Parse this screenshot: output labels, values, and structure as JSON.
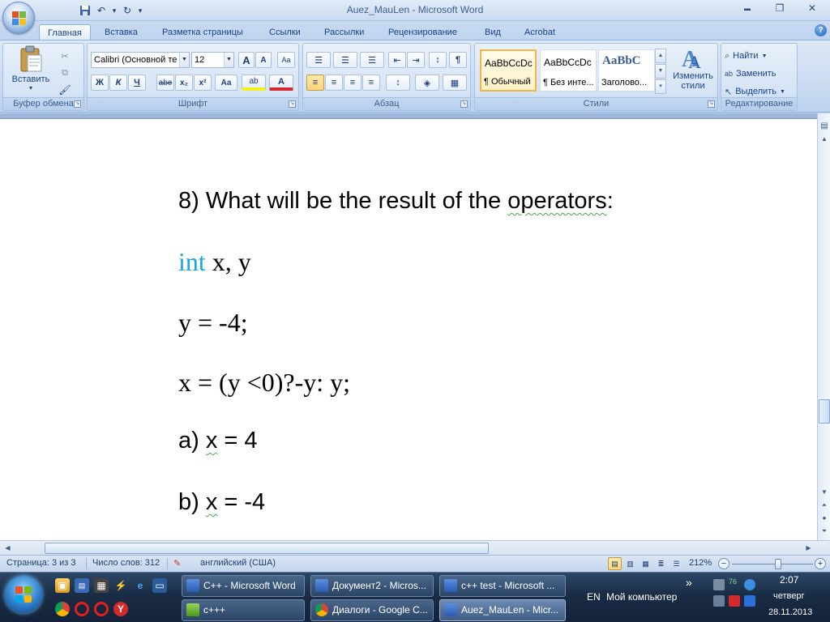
{
  "window": {
    "title": "Auez_MauLen - Microsoft Word",
    "minimize": "▬",
    "maximize": "❐",
    "close": "✕"
  },
  "qat": {
    "save": "💾",
    "undo": "↶",
    "undo_dd": "▾",
    "redo": "↻",
    "customize": "▾"
  },
  "tabs": [
    {
      "label": "Главная",
      "active": true
    },
    {
      "label": "Вставка"
    },
    {
      "label": "Разметка страницы"
    },
    {
      "label": "Ссылки"
    },
    {
      "label": "Рассылки"
    },
    {
      "label": "Рецензирование"
    },
    {
      "label": "Вид"
    },
    {
      "label": "Acrobat"
    }
  ],
  "help": "?",
  "ribbon": {
    "clipboard": {
      "label": "Буфер обмена",
      "paste": "Вставить",
      "paste_dd": "▾",
      "cut": "✂",
      "copy": "⧉",
      "format_painter": "🖌"
    },
    "font": {
      "label": "Шрифт",
      "font_name": "Calibri (Основной те",
      "font_size": "12",
      "grow": "A",
      "shrink": "A",
      "clear": "Aa",
      "bold": "Ж",
      "italic": "К",
      "underline": "Ч",
      "strike": "abe",
      "subscript": "x₂",
      "superscript": "x²",
      "case": "Aa",
      "highlight": "ab",
      "color": "A"
    },
    "paragraph": {
      "label": "Абзац",
      "bullets": "☰",
      "numbering": "☰",
      "multilevel": "☰",
      "dec_indent": "⇤",
      "inc_indent": "⇥",
      "sort": "↕",
      "pilcrow": "¶",
      "align_left": "≡",
      "align_center": "≡",
      "align_right": "≡",
      "justify": "≡",
      "line_spacing": "↕",
      "shading": "◈",
      "borders": "▦"
    },
    "styles": {
      "label": "Стили",
      "items": [
        {
          "sample": "AaBbCcDc",
          "name": "¶ Обычный",
          "active": true
        },
        {
          "sample": "AaBbCcDc",
          "name": "¶ Без инте..."
        },
        {
          "sample": "AaBbC",
          "name": "Заголово..."
        }
      ],
      "change_styles": "Изменить стили",
      "change_dd": "▾"
    },
    "editing": {
      "label": "Редактирование",
      "find": "Найти",
      "replace": "Заменить",
      "select": "Выделить"
    }
  },
  "document": {
    "line1": "8) What will be the result of the ",
    "line1_b": "operators",
    "line1_c": ":",
    "line2_kw": "int",
    "line2_rest": " x, y",
    "line3": "y = -4;",
    "line4": "x = (y <0)?-y: y;",
    "line5_a": "a) ",
    "line5_b": "x",
    "line5_c": " = 4",
    "line6_a": "b) ",
    "line6_b": "x",
    "line6_c": " = -4"
  },
  "statusbar": {
    "page": "Страница: 3 из 3",
    "words": "Число слов: 312",
    "language": "английский (США)",
    "zoom": "212%",
    "zoom_out": "−",
    "zoom_in": "+"
  },
  "taskbar": {
    "tasks": [
      {
        "label": "C++ - Microsoft Word",
        "active": false
      },
      {
        "label": "Документ2 - Micros..."
      },
      {
        "label": "c++ test - Microsoft ..."
      },
      {
        "label": "c+++"
      },
      {
        "label": "Диалоги - Google C..."
      },
      {
        "label": "Auez_MauLen - Micr...",
        "active": true
      }
    ],
    "more": "»",
    "lang": "EN",
    "my_computer": "Мой компьютер",
    "clock_time": "2:07",
    "clock_day": "четверг",
    "clock_date": "28.11.2013",
    "tray_count": "76"
  },
  "colors": {
    "ribbon_bg": "#c7d9f0",
    "keyword": "#1aa6e0",
    "taskbar": "#1a2c45"
  }
}
